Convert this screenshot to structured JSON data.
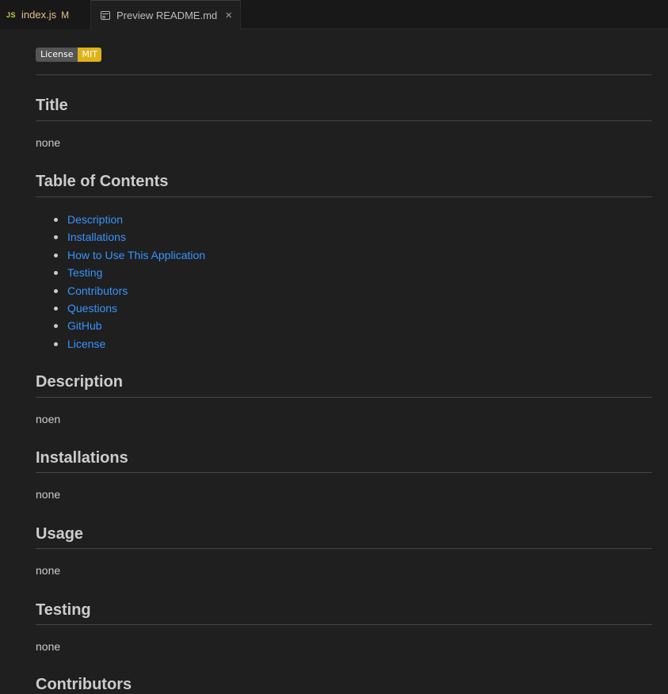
{
  "tabs": [
    {
      "icon": "JS",
      "label": "index.js",
      "modified": "M"
    },
    {
      "label": "Preview README.md",
      "close": "×"
    }
  ],
  "badge": {
    "left": "License",
    "right": "MIT"
  },
  "sections": {
    "title": {
      "heading": "Title",
      "body": "none"
    },
    "toc": {
      "heading": "Table of Contents",
      "items": [
        "Description",
        "Installations",
        "How to Use This Application",
        "Testing",
        "Contributors",
        "Questions",
        "GitHub",
        "License"
      ]
    },
    "description": {
      "heading": "Description",
      "body": "noen"
    },
    "installations": {
      "heading": "Installations",
      "body": "none"
    },
    "usage": {
      "heading": "Usage",
      "body": "none"
    },
    "testing": {
      "heading": "Testing",
      "body": "none"
    },
    "contributors": {
      "heading": "Contributors"
    }
  },
  "colors": {
    "link": "#3794ff",
    "badge_right": "#dfb317",
    "badge_left": "#555555",
    "background": "#1f1f1f"
  }
}
